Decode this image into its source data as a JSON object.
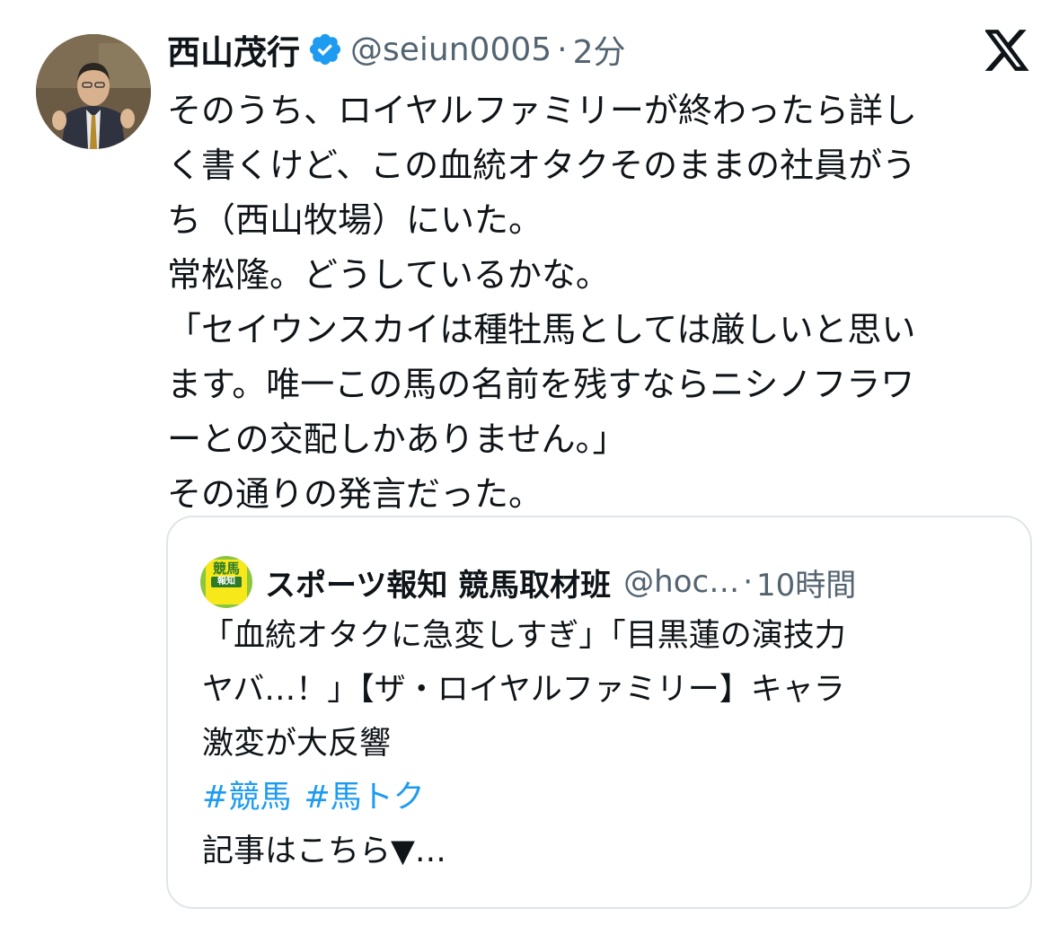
{
  "author": {
    "display_name": "西山茂行",
    "handle": "@seiun0005",
    "separator": "·",
    "time": "2分"
  },
  "tweet": {
    "lines": [
      "そのうち、ロイヤルファミリーが終わったら詳し",
      "く書くけど、この血統オタクそのままの社員がう",
      "ち（西山牧場）にいた。",
      "常松隆。どうしているかな。",
      "「セイウンスカイは種牡馬としては厳しいと思い",
      "ます。唯一この馬の名前を残すならニシノフラワ",
      "ーとの交配しかありません。」",
      "その通りの発言だった。"
    ]
  },
  "quote": {
    "avatar_text": "競馬",
    "avatar_sub": "報知",
    "display_name": "スポーツ報知 競馬取材班",
    "handle": "@hoc…",
    "separator": "·",
    "time": "10時間",
    "lines": [
      "「血統オタクに急変しすぎ」「目黒蓮の演技力",
      "ヤバ…！」【ザ・ロイヤルファミリー】キャラ",
      "激変が大反響"
    ],
    "hashtags": [
      "#競馬",
      "#馬トク"
    ],
    "more": "記事はこちら▼…"
  },
  "colors": {
    "link": "#1d9bf0",
    "verified": "#1d9bf0",
    "secondary_text": "#536471",
    "border": "#dfe5ea"
  },
  "icons": {
    "verified": "verified-badge-icon",
    "logo": "x-logo-icon"
  }
}
